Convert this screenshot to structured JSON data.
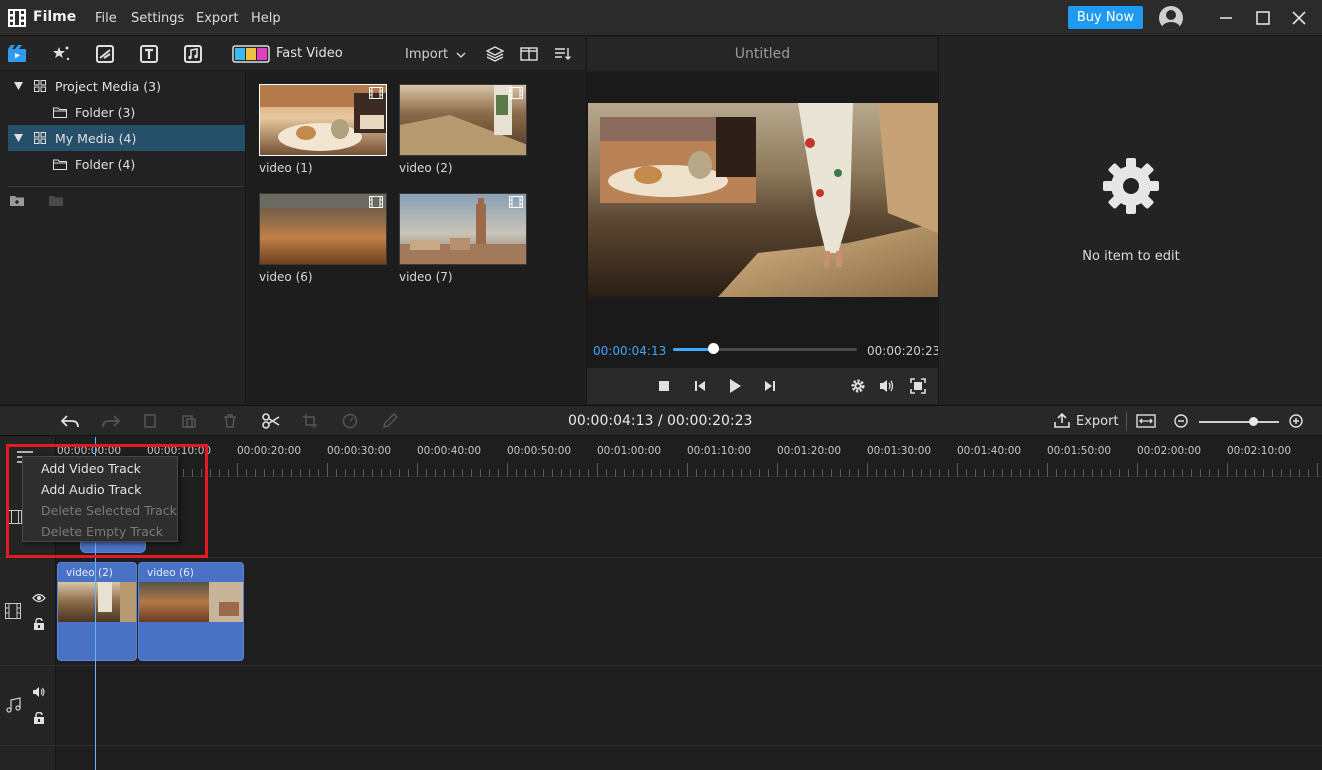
{
  "app": {
    "name": "Filme",
    "buy_now": "Buy Now",
    "accent": "#1e9bf0"
  },
  "menu": [
    "File",
    "Settings",
    "Export",
    "Help"
  ],
  "media_toolbar": {
    "tools": [
      "media-icon",
      "effects-icon",
      "transition-icon",
      "text-icon",
      "music-icon"
    ],
    "fast_video": "Fast Video",
    "import": "Import"
  },
  "tree": [
    {
      "label": "Project Media (3)",
      "level": 0,
      "expanded": true,
      "selected": false
    },
    {
      "label": "Folder (3)",
      "level": 1,
      "selected": false
    },
    {
      "label": "My Media (4)",
      "level": 0,
      "expanded": true,
      "selected": true
    },
    {
      "label": "Folder (4)",
      "level": 1,
      "selected": false
    }
  ],
  "library": [
    {
      "label": "video (1)",
      "selected": true
    },
    {
      "label": "video (2)",
      "selected": false
    },
    {
      "label": "video (6)",
      "selected": false
    },
    {
      "label": "video (7)",
      "selected": false
    }
  ],
  "preview": {
    "title": "Untitled",
    "current_time": "00:00:04:13",
    "end_time": "00:00:20:23",
    "progress": 0.22
  },
  "edit_panel": {
    "message": "No item to edit"
  },
  "timeline": {
    "time_display": "00:00:04:13 / 00:00:20:23",
    "export": "Export",
    "zoom": 0.68,
    "ruler": [
      "00:00:00:00",
      "00:00:10:00",
      "00:00:20:00",
      "00:00:30:00",
      "00:00:40:00",
      "00:00:50:00",
      "00:01:00:00",
      "00:01:10:00",
      "00:01:20:00",
      "00:01:30:00",
      "00:01:40:00",
      "00:01:50:00",
      "00:02:00:00",
      "00:02:10:00"
    ],
    "clips": [
      {
        "label": "video (2)"
      },
      {
        "label": "video (6)"
      }
    ]
  },
  "context_menu": {
    "items": [
      {
        "label": "Add Video Track",
        "enabled": true
      },
      {
        "label": "Add Audio Track",
        "enabled": true
      },
      {
        "label": "Delete Selected Track",
        "enabled": false
      },
      {
        "label": "Delete Empty Track",
        "enabled": false
      }
    ]
  }
}
